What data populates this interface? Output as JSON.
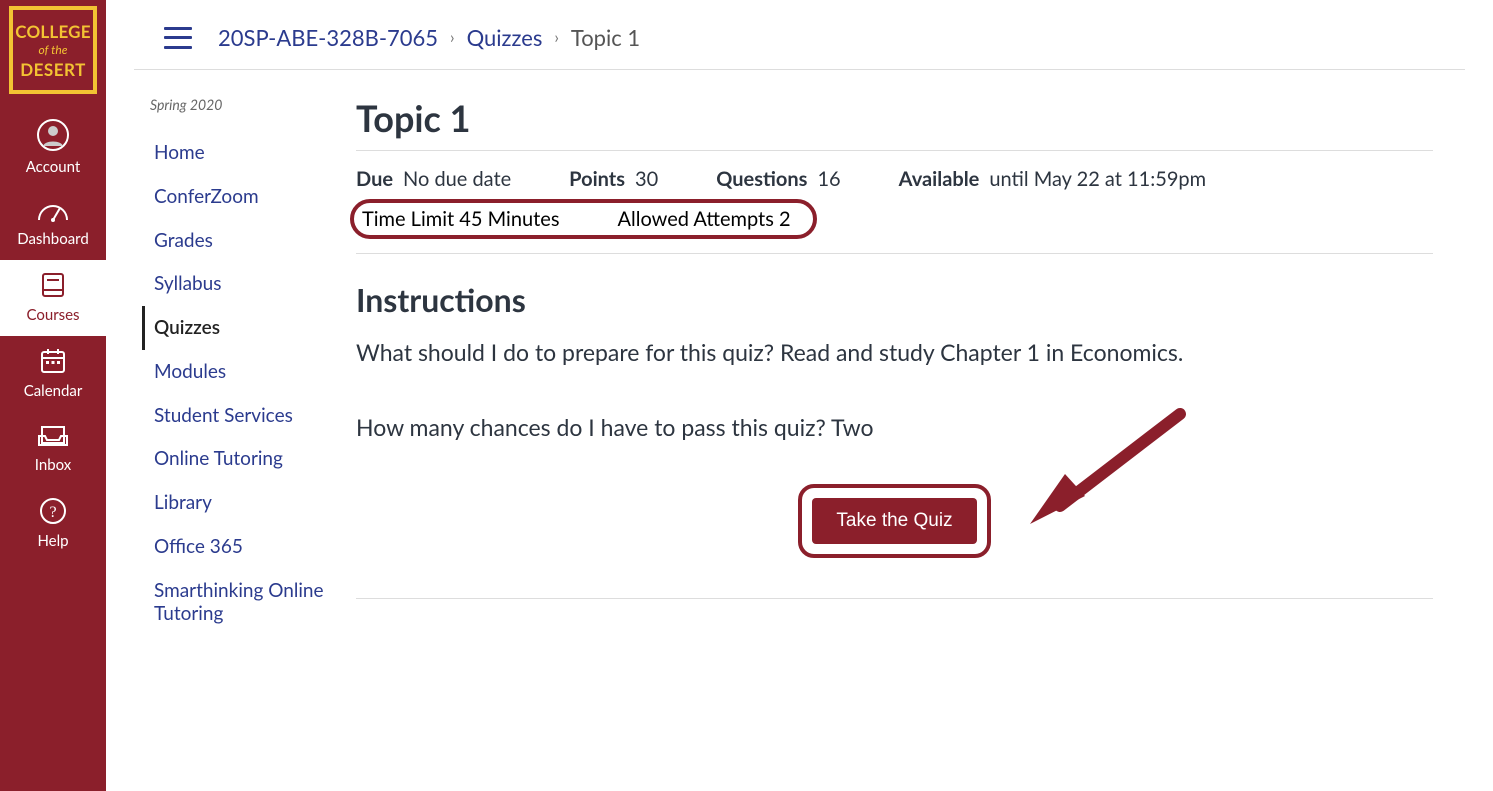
{
  "logo": {
    "line1": "COLLEGE",
    "line2": "of the",
    "line3": "DESERT"
  },
  "globalNav": {
    "account": "Account",
    "dashboard": "Dashboard",
    "courses": "Courses",
    "calendar": "Calendar",
    "inbox": "Inbox",
    "help": "Help"
  },
  "breadcrumb": {
    "course": "20SP-ABE-328B-7065",
    "section": "Quizzes",
    "current": "Topic 1"
  },
  "term": "Spring 2020",
  "courseNav": [
    "Home",
    "ConferZoom",
    "Grades",
    "Syllabus",
    "Quizzes",
    "Modules",
    "Student Services",
    "Online Tutoring",
    "Library",
    "Office 365",
    "Smarthinking Online Tutoring"
  ],
  "quiz": {
    "title": "Topic 1",
    "labels": {
      "due": "Due",
      "points": "Points",
      "questions": "Questions",
      "available": "Available",
      "timeLimit": "Time Limit",
      "allowedAttempts": "Allowed Attempts"
    },
    "dueValue": "No due date",
    "pointsValue": "30",
    "questionsValue": "16",
    "availableValue": "until May 22 at 11:59pm",
    "timeLimitValue": "45 Minutes",
    "allowedAttemptsValue": "2",
    "instructionsHeading": "Instructions",
    "instructionsP1": "What should I do to prepare for this quiz? Read and study  Chapter 1 in Economics.",
    "instructionsP2": "How many chances do I have to pass this quiz? Two",
    "takeButton": "Take the Quiz"
  }
}
